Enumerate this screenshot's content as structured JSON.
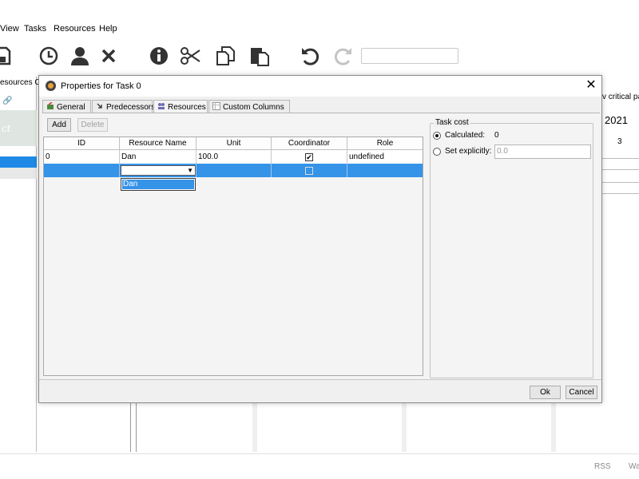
{
  "menubar": {
    "items": [
      "View",
      "Tasks",
      "Resources",
      "Help"
    ]
  },
  "toolbar": {
    "icons": [
      "save-icon",
      "clock-icon",
      "person-icon",
      "delete-icon",
      "info-icon",
      "cut-icon",
      "copy-icon",
      "paste-icon",
      "undo-icon",
      "redo-icon"
    ],
    "search_value": ""
  },
  "left_panel": {
    "tab_label": "esources Ch",
    "logo_text": "ct"
  },
  "right_panel": {
    "header": "v critical pa",
    "year": "2021",
    "day": "3"
  },
  "status": {
    "rss": "RSS",
    "wa": "Wa"
  },
  "dialog": {
    "title": "Properties for Task 0",
    "tabs": [
      {
        "label": "General"
      },
      {
        "label": "Predecessors"
      },
      {
        "label": "Resources"
      },
      {
        "label": "Custom Columns"
      }
    ],
    "add_label": "Add",
    "delete_label": "Delete",
    "table": {
      "headers": [
        "ID",
        "Resource Name",
        "Unit",
        "Coordinator",
        "Role"
      ],
      "rows": [
        {
          "id": "0",
          "name": "Dan",
          "unit": "100.0",
          "coordinator": true,
          "role": "undefined"
        },
        {
          "id": "",
          "name": "",
          "unit": "",
          "coordinator": false,
          "role": ""
        }
      ],
      "dropdown_option": "Dan"
    },
    "cost": {
      "legend": "Task cost",
      "calculated_label": "Calculated:",
      "calculated_value": "0",
      "explicit_label": "Set explicitly:",
      "explicit_placeholder": "0.0",
      "selected": "calculated"
    },
    "ok_label": "Ok",
    "cancel_label": "Cancel"
  },
  "colors": {
    "selection": "#3593e8",
    "accent": "#1e8ae6"
  }
}
